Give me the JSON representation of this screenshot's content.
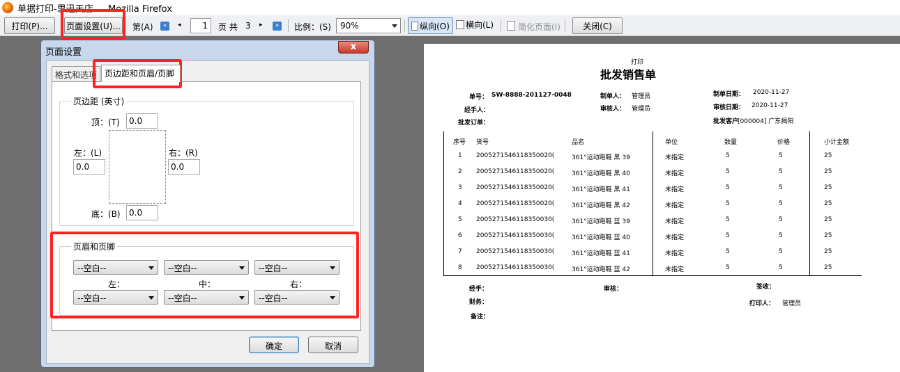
{
  "window": {
    "title": "单据打印-思迅天店 — Mozilla Firefox"
  },
  "toolbar": {
    "print": "打印(P)...",
    "page_setup": "页面设置(U)...",
    "page_prefix": "第(A)",
    "page_current": "1",
    "page_mid": "页 共",
    "page_total": "3",
    "scale_label": "比例：(S)",
    "scale_value": "90%",
    "portrait": "纵向(O)",
    "landscape": "横向(L)",
    "simplify": "简化页面(I)",
    "close": "关闭(C)"
  },
  "dialog": {
    "title": "页面设置",
    "close": "x",
    "tab1": "格式和选项",
    "tab2": "页边距和页眉/页脚",
    "margins_group": "页边距 (英寸)",
    "top_label": "顶：(T)",
    "top_value": "0.0",
    "left_label": "左：(L)",
    "left_value": "0.0",
    "right_label": "右：(R)",
    "right_value": "0.0",
    "bottom_label": "底：(B)",
    "bottom_value": "0.0",
    "hf_group": "页眉和页脚",
    "blank": "--空白--",
    "col_left": "左：",
    "col_center": "中：",
    "col_right": "右：",
    "ok": "确定",
    "cancel": "取消"
  },
  "doc": {
    "print_label": "打印",
    "title": "批发销售单",
    "order_no_label": "单号：",
    "order_no": "SW-8888-201127-0048",
    "maker_label": "制单人：",
    "maker": "管理员",
    "make_date_label": "制单日期：",
    "make_date": "2020-11-27",
    "handler_label": "经手人：",
    "reviewer_label": "审核人：",
    "reviewer": "管理员",
    "review_date_label": "审核日期：",
    "review_date": "2020-11-27",
    "wholesale_order_label": "批发订单：",
    "customer_label": "批发客户",
    "customer": "[000004] 广东揭阳",
    "columns": [
      "序号",
      "货号",
      "品名",
      "单位",
      "数量",
      "价格",
      "小计金额"
    ],
    "rows": [
      [
        "1",
        "2005271546118350020(",
        "361°运动跑鞋 黑 39",
        "未指定",
        "5",
        "5",
        "25"
      ],
      [
        "2",
        "2005271546118350020(",
        "361°运动跑鞋 黑 40",
        "未指定",
        "5",
        "5",
        "25"
      ],
      [
        "3",
        "2005271546118350020(",
        "361°运动跑鞋 黑 41",
        "未指定",
        "5",
        "5",
        "25"
      ],
      [
        "4",
        "2005271546118350020(",
        "361°运动跑鞋 黑 42",
        "未指定",
        "5",
        "5",
        "25"
      ],
      [
        "5",
        "2005271546118350030(",
        "361°运动跑鞋 蓝 39",
        "未指定",
        "5",
        "5",
        "25"
      ],
      [
        "6",
        "2005271546118350030(",
        "361°运动跑鞋 蓝 40",
        "未指定",
        "5",
        "5",
        "25"
      ],
      [
        "7",
        "2005271546118350030(",
        "361°运动跑鞋 蓝 41",
        "未指定",
        "5",
        "5",
        "25"
      ],
      [
        "8",
        "2005271546118350030(",
        "361°运动跑鞋 蓝 42",
        "未指定",
        "5",
        "5",
        "25"
      ]
    ],
    "footer": {
      "handler": "经手：",
      "review": "审核：",
      "sign": "签收：",
      "finance": "财务：",
      "printer_label": "打印人：",
      "printer": "管理员",
      "remark": "备注："
    }
  },
  "colors": {
    "highlight": "#ff2222",
    "dialog_frame": "#c7d8ec",
    "background": "#6f6f6f"
  }
}
